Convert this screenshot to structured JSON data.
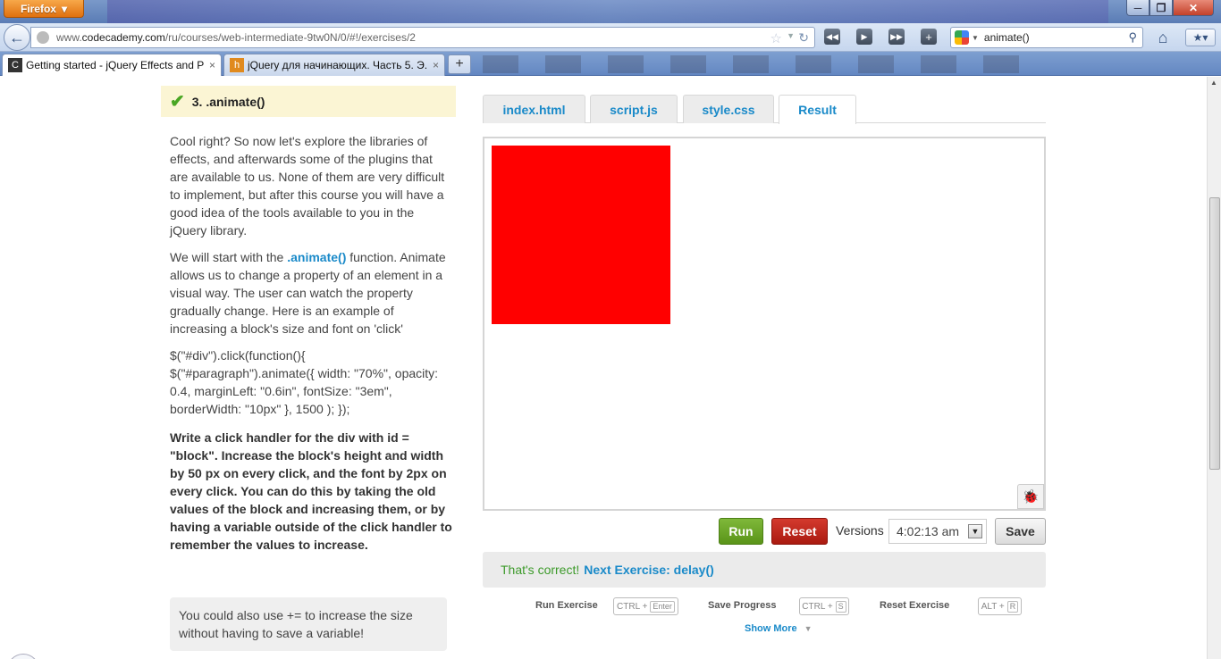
{
  "browser": {
    "menu_label": "Firefox",
    "menu_caret": "▾",
    "url_prefix": "www.",
    "url_host": "codecademy.com",
    "url_path": "/ru/courses/web-intermediate-9tw0N/0/#!/exercises/2",
    "search_value": "animate()",
    "tabs": [
      {
        "title": "Getting started - jQuery Effects and Pl...",
        "favicon": "C",
        "active": true
      },
      {
        "title": "jQuery для начинающих. Часть 5. Э...",
        "favicon": "h",
        "active": false
      }
    ],
    "close_glyph": "×",
    "new_tab_glyph": "+",
    "window_buttons": {
      "minimize": "─",
      "maximize": "❐",
      "close": "✕"
    }
  },
  "exercise": {
    "number_title": "3. .animate()",
    "intro": "Cool right? So now let's explore the libraries of effects, and afterwards some of the plugins that are available to us. None of them are very difficult to implement, but after this course you will have a good idea of the tools available to you in the jQuery library.",
    "start_before": "We will start with the ",
    "start_link": ".animate()",
    "start_after": " function. Animate allows us to change a property of an element in a visual way. The user can watch the property gradually change. Here is an example of increasing a block's size and font on 'click'",
    "code_example": "$(\"#div\").click(function(){ $(\"#paragraph\").animate({ width: \"70%\", opacity: 0.4, marginLeft: \"0.6in\", fontSize: \"3em\", borderWidth: \"10px\" }, 1500 ); });",
    "task": "Write a click handler for the div with id = \"block\". Increase the block's height and width by 50 px on every click, and the font by 2px on every click. You can do this by taking the old values of the block and increasing them, or by having a variable outside of the click handler to remember the values to increase.",
    "hint": "You could also use += to increase the size without having to save a variable!"
  },
  "editor": {
    "tabs": [
      "index.html",
      "script.js",
      "style.css",
      "Result"
    ],
    "active_tab": "Result",
    "block_color": "#ff0000",
    "run_label": "Run",
    "reset_label": "Reset",
    "versions_label": "Versions",
    "version_value": "4:02:13 am",
    "save_label": "Save",
    "feedback_ok": "That's correct!",
    "feedback_next": "Next Exercise: delay()",
    "shortcuts": [
      {
        "label": "Run Exercise",
        "mod": "CTRL +",
        "key": "Enter"
      },
      {
        "label": "Save Progress",
        "mod": "CTRL +",
        "key": "S"
      },
      {
        "label": "Reset Exercise",
        "mod": "ALT +",
        "key": "R"
      }
    ],
    "show_more": "Show More"
  },
  "colors": {
    "link_blue": "#1a8ac9",
    "run_green": "#5a9419",
    "reset_red": "#aa1a10",
    "header_yellow": "#fbf5d4"
  }
}
